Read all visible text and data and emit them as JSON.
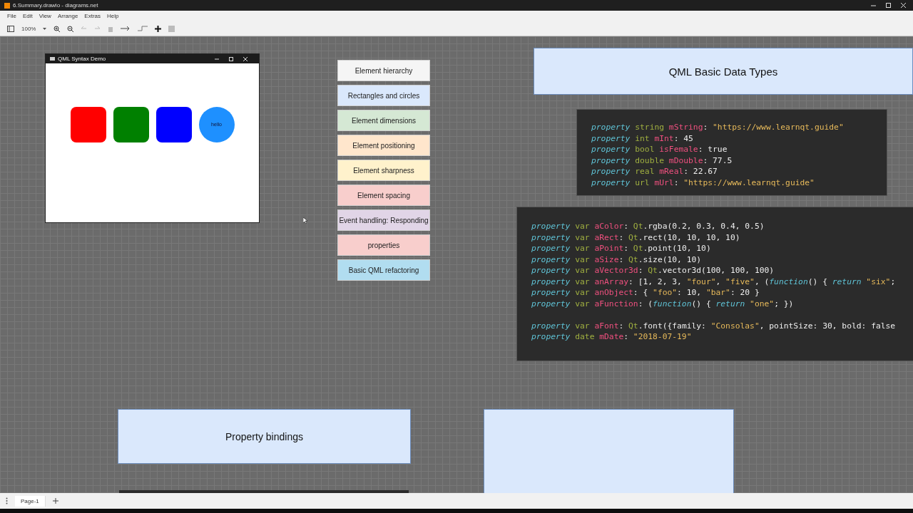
{
  "window": {
    "title": "6.Summary.drawio - diagrams.net"
  },
  "menu": [
    "File",
    "Edit",
    "View",
    "Arrange",
    "Extras",
    "Help"
  ],
  "toolbar": {
    "zoom": "100%"
  },
  "demo_window": {
    "title": "QML Syntax Demo",
    "shapes": [
      {
        "kind": "rect",
        "color": "#ff0000"
      },
      {
        "kind": "rect",
        "color": "#008000"
      },
      {
        "kind": "rect",
        "color": "#0000ff"
      },
      {
        "kind": "circle",
        "color": "#1e90ff",
        "label": "hello"
      }
    ]
  },
  "topics": [
    {
      "label": "Element hierarchy",
      "color": "#f5f5f5"
    },
    {
      "label": "Rectangles and circles",
      "color": "#dae8fc"
    },
    {
      "label": "Element dimensions",
      "color": "#d5e8d4"
    },
    {
      "label": "Element positioning",
      "color": "#ffe6cc"
    },
    {
      "label": "Element sharpness",
      "color": "#fff2cc"
    },
    {
      "label": "Element spacing",
      "color": "#f8cecc"
    },
    {
      "label": "Event handling: Responding",
      "color": "#e1d5e7"
    },
    {
      "label": "properties",
      "color": "#f8cecc"
    },
    {
      "label": "Basic QML refactoring",
      "color": "#b1ddf0"
    }
  ],
  "heading": "QML Basic Data Types",
  "code_basic": [
    [
      {
        "kind": "keyword",
        "text": "property"
      },
      {
        "kind": "type",
        "text": " string "
      },
      {
        "kind": "name",
        "text": "mString"
      },
      {
        "kind": "plain",
        "text": ": "
      },
      {
        "kind": "string",
        "text": "\"https://www.learnqt.guide\""
      }
    ],
    [
      {
        "kind": "keyword",
        "text": "property"
      },
      {
        "kind": "type",
        "text": " int "
      },
      {
        "kind": "name",
        "text": "mInt"
      },
      {
        "kind": "plain",
        "text": ": 45"
      }
    ],
    [
      {
        "kind": "keyword",
        "text": "property"
      },
      {
        "kind": "type",
        "text": " bool "
      },
      {
        "kind": "name",
        "text": "isFemale"
      },
      {
        "kind": "plain",
        "text": ": true"
      }
    ],
    [
      {
        "kind": "keyword",
        "text": "property"
      },
      {
        "kind": "type",
        "text": " double "
      },
      {
        "kind": "name",
        "text": "mDouble"
      },
      {
        "kind": "plain",
        "text": ": 77.5"
      }
    ],
    [
      {
        "kind": "keyword",
        "text": "property"
      },
      {
        "kind": "type",
        "text": " real "
      },
      {
        "kind": "name",
        "text": "mReal"
      },
      {
        "kind": "plain",
        "text": ": 22.67"
      }
    ],
    [
      {
        "kind": "keyword",
        "text": "property"
      },
      {
        "kind": "type",
        "text": " url "
      },
      {
        "kind": "name",
        "text": "mUrl"
      },
      {
        "kind": "plain",
        "text": ": "
      },
      {
        "kind": "string",
        "text": "\"https://www.learnqt.guide\""
      }
    ]
  ],
  "code_var_groups": [
    [
      [
        {
          "kind": "keyword",
          "text": "property"
        },
        {
          "kind": "type",
          "text": " var "
        },
        {
          "kind": "name",
          "text": "aColor"
        },
        {
          "kind": "plain",
          "text": ": "
        },
        {
          "kind": "type",
          "text": "Qt"
        },
        {
          "kind": "plain",
          "text": ".rgba(0.2, 0.3, 0.4, 0.5)"
        }
      ],
      [
        {
          "kind": "keyword",
          "text": "property"
        },
        {
          "kind": "type",
          "text": " var "
        },
        {
          "kind": "name",
          "text": "aRect"
        },
        {
          "kind": "plain",
          "text": ": "
        },
        {
          "kind": "type",
          "text": "Qt"
        },
        {
          "kind": "plain",
          "text": ".rect(10, 10, 10, 10)"
        }
      ],
      [
        {
          "kind": "keyword",
          "text": "property"
        },
        {
          "kind": "type",
          "text": " var "
        },
        {
          "kind": "name",
          "text": "aPoint"
        },
        {
          "kind": "plain",
          "text": ": "
        },
        {
          "kind": "type",
          "text": "Qt"
        },
        {
          "kind": "plain",
          "text": ".point(10, 10)"
        }
      ],
      [
        {
          "kind": "keyword",
          "text": "property"
        },
        {
          "kind": "type",
          "text": " var "
        },
        {
          "kind": "name",
          "text": "aSize"
        },
        {
          "kind": "plain",
          "text": ": "
        },
        {
          "kind": "type",
          "text": "Qt"
        },
        {
          "kind": "plain",
          "text": ".size(10, 10)"
        }
      ],
      [
        {
          "kind": "keyword",
          "text": "property"
        },
        {
          "kind": "type",
          "text": " var "
        },
        {
          "kind": "name",
          "text": "aVector3d"
        },
        {
          "kind": "plain",
          "text": ": "
        },
        {
          "kind": "type",
          "text": "Qt"
        },
        {
          "kind": "plain",
          "text": ".vector3d(100, 100, 100)"
        }
      ],
      [
        {
          "kind": "keyword",
          "text": "property"
        },
        {
          "kind": "type",
          "text": " var "
        },
        {
          "kind": "name",
          "text": "anArray"
        },
        {
          "kind": "plain",
          "text": ": [1, 2, 3, "
        },
        {
          "kind": "string",
          "text": "\"four\""
        },
        {
          "kind": "plain",
          "text": ", "
        },
        {
          "kind": "string",
          "text": "\"five\""
        },
        {
          "kind": "plain",
          "text": ", ("
        },
        {
          "kind": "keyword",
          "text": "function"
        },
        {
          "kind": "plain",
          "text": "() { "
        },
        {
          "kind": "keyword",
          "text": "return"
        },
        {
          "kind": "string",
          "text": " \"six\""
        },
        {
          "kind": "plain",
          "text": ";"
        }
      ],
      [
        {
          "kind": "keyword",
          "text": "property"
        },
        {
          "kind": "type",
          "text": " var "
        },
        {
          "kind": "name",
          "text": "anObject"
        },
        {
          "kind": "plain",
          "text": ": { "
        },
        {
          "kind": "string",
          "text": "\"foo\""
        },
        {
          "kind": "plain",
          "text": ": 10, "
        },
        {
          "kind": "string",
          "text": "\"bar\""
        },
        {
          "kind": "plain",
          "text": ": 20 }"
        }
      ],
      [
        {
          "kind": "keyword",
          "text": "property"
        },
        {
          "kind": "type",
          "text": " var "
        },
        {
          "kind": "name",
          "text": "aFunction"
        },
        {
          "kind": "plain",
          "text": ": ("
        },
        {
          "kind": "keyword",
          "text": "function"
        },
        {
          "kind": "plain",
          "text": "() { "
        },
        {
          "kind": "keyword",
          "text": "return"
        },
        {
          "kind": "string",
          "text": " \"one\""
        },
        {
          "kind": "plain",
          "text": "; })"
        }
      ]
    ],
    [
      [
        {
          "kind": "keyword",
          "text": "property"
        },
        {
          "kind": "type",
          "text": " var "
        },
        {
          "kind": "name",
          "text": "aFont"
        },
        {
          "kind": "plain",
          "text": ": "
        },
        {
          "kind": "type",
          "text": "Qt"
        },
        {
          "kind": "plain",
          "text": ".font({family: "
        },
        {
          "kind": "string",
          "text": "\"Consolas\""
        },
        {
          "kind": "plain",
          "text": ", pointSize: 30, bold: false"
        }
      ],
      [
        {
          "kind": "keyword",
          "text": "property"
        },
        {
          "kind": "type",
          "text": " date "
        },
        {
          "kind": "name",
          "text": "mDate"
        },
        {
          "kind": "plain",
          "text": ": "
        },
        {
          "kind": "string",
          "text": "\"2018-07-19\""
        }
      ]
    ]
  ],
  "bindings_box": "Property bindings",
  "pages": [
    {
      "label": "Page-1",
      "selected": true
    }
  ]
}
